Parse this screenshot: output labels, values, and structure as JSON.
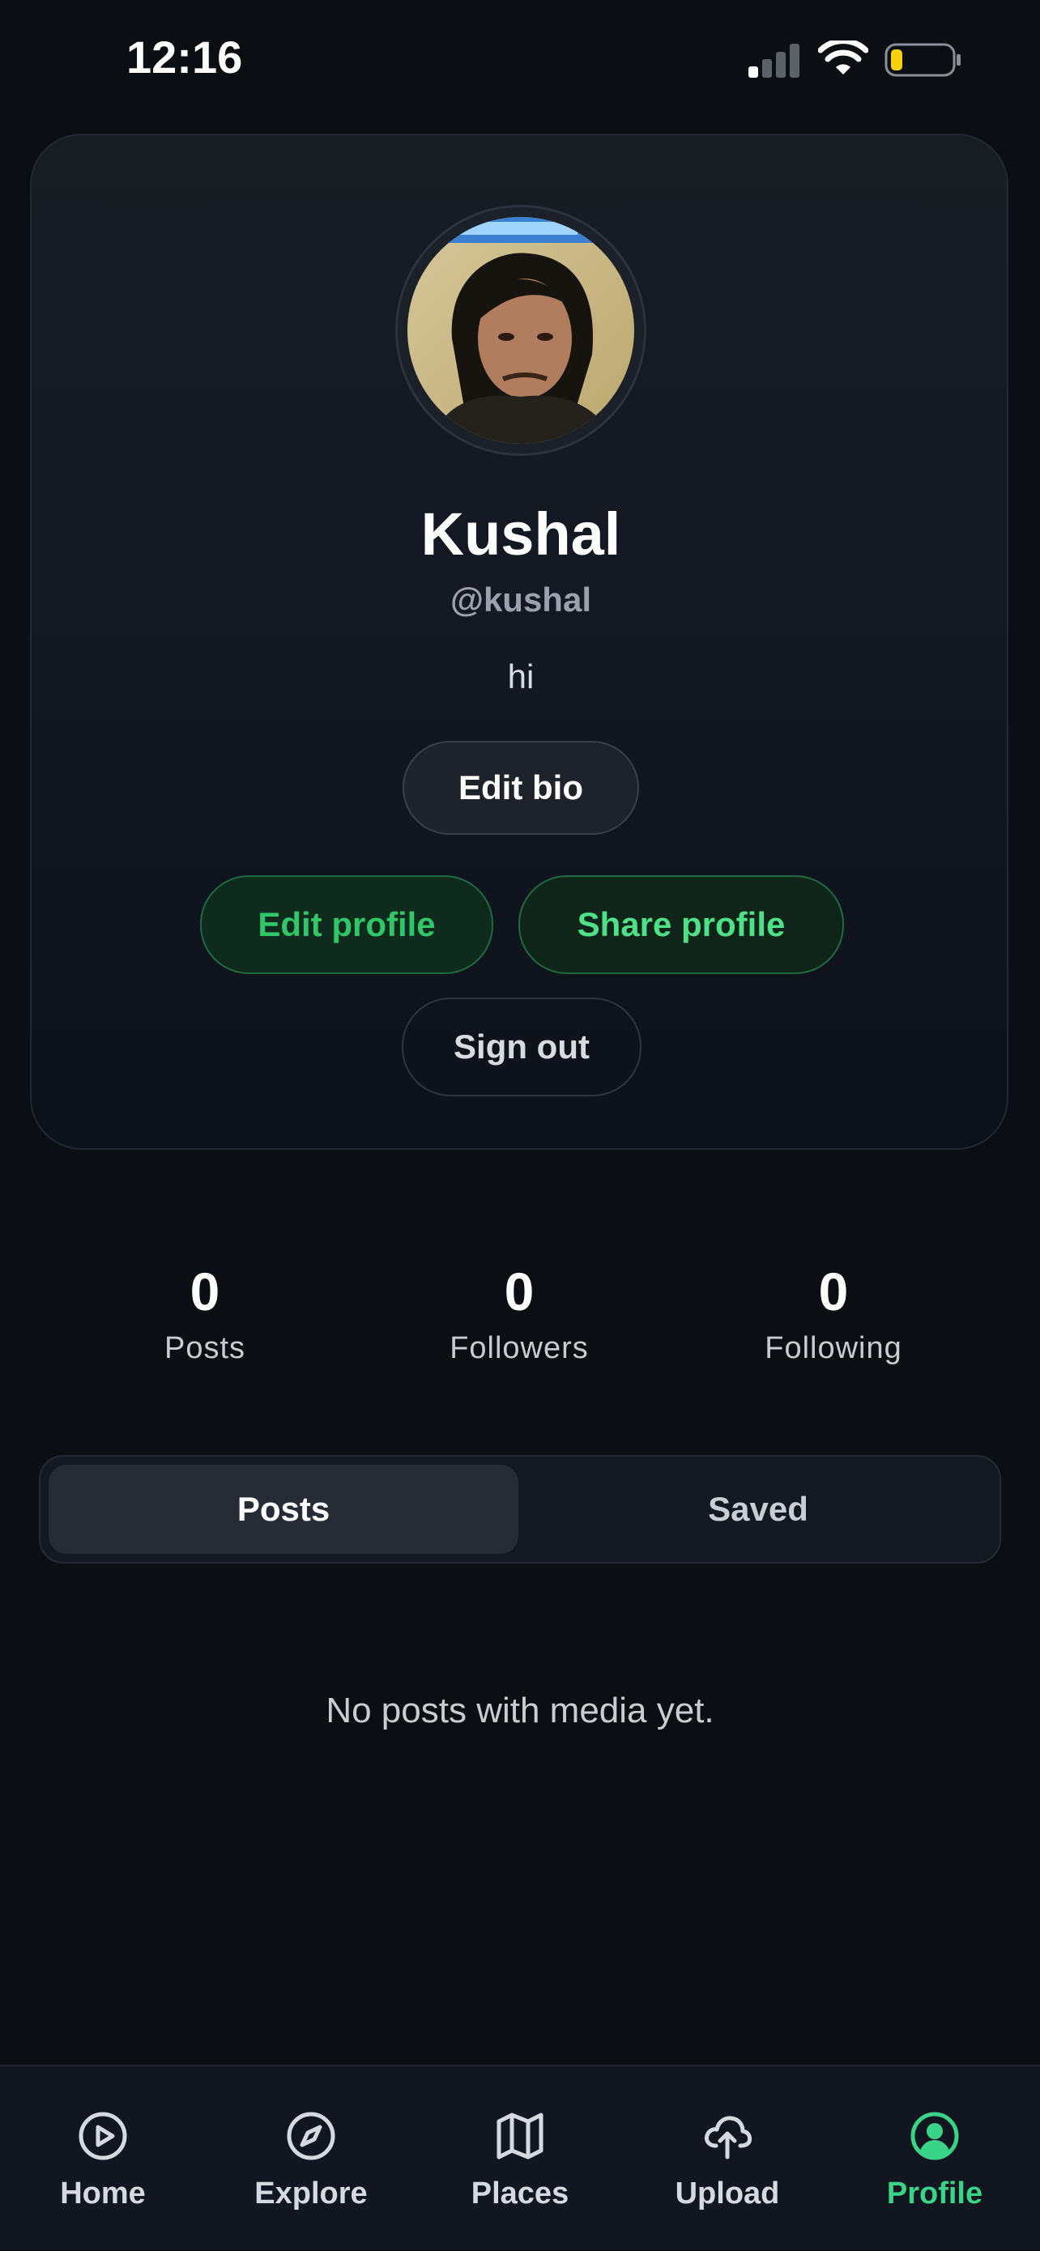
{
  "status_bar": {
    "time": "12:16"
  },
  "profile": {
    "name": "Kushal",
    "handle": "@kushal",
    "bio": "hi",
    "buttons": {
      "edit_bio": "Edit bio",
      "edit_profile": "Edit profile",
      "share_profile": "Share profile",
      "sign_out": "Sign out"
    }
  },
  "stats": [
    {
      "value": "0",
      "label": "Posts"
    },
    {
      "value": "0",
      "label": "Followers"
    },
    {
      "value": "0",
      "label": "Following"
    }
  ],
  "tabs": [
    {
      "label": "Posts",
      "active": true
    },
    {
      "label": "Saved",
      "active": false
    }
  ],
  "empty_state": "No posts with media yet.",
  "bottom_nav": [
    {
      "label": "Home",
      "icon": "play-circle-icon"
    },
    {
      "label": "Explore",
      "icon": "compass-icon"
    },
    {
      "label": "Places",
      "icon": "map-icon"
    },
    {
      "label": "Upload",
      "icon": "cloud-upload-icon"
    },
    {
      "label": "Profile",
      "icon": "user-circle-icon",
      "active": true
    }
  ],
  "colors": {
    "background": "#0b0e13",
    "accent": "#3ad488",
    "battery_level": "#f5d20b"
  }
}
